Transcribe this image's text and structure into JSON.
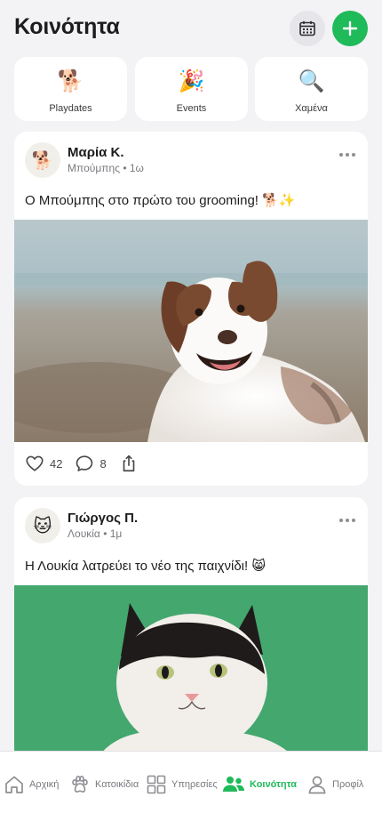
{
  "header": {
    "title": "Κοινότητα"
  },
  "quick_actions": [
    {
      "emoji": "🐕",
      "label": "Playdates"
    },
    {
      "emoji": "🎉",
      "label": "Events"
    },
    {
      "emoji": "🔍",
      "label": "Χαμένα"
    }
  ],
  "posts": [
    {
      "avatar": "🐕",
      "author": "Μαρία Κ.",
      "pet": "Μπούμπης",
      "time": "1ω",
      "meta": "Μπούμπης • 1ω",
      "text": "Ο Μπούμπης στο πρώτο του grooming! 🐕✨",
      "photo": "dog-photo",
      "likes": "42",
      "comments": "8"
    },
    {
      "avatar": "🐱",
      "author": "Γιώργος Π.",
      "pet": "Λουκία",
      "time": "1μ",
      "meta": "Λουκία • 1μ",
      "text": "Η Λουκία λατρεύει το νέο της παιχνίδι! 😸",
      "photo": "cat-photo"
    }
  ],
  "tabbar": [
    {
      "label": "Αρχική",
      "icon": "home-icon",
      "active": false
    },
    {
      "label": "Κατοικίδια",
      "icon": "paw-icon",
      "active": false
    },
    {
      "label": "Υπηρεσίες",
      "icon": "grid-icon",
      "active": false
    },
    {
      "label": "Κοινότητα",
      "icon": "people-icon",
      "active": true
    },
    {
      "label": "Προφίλ",
      "icon": "person-icon",
      "active": false
    }
  ],
  "colors": {
    "accent": "#1fba5a",
    "background": "#f3f3f5",
    "card": "#ffffff"
  }
}
